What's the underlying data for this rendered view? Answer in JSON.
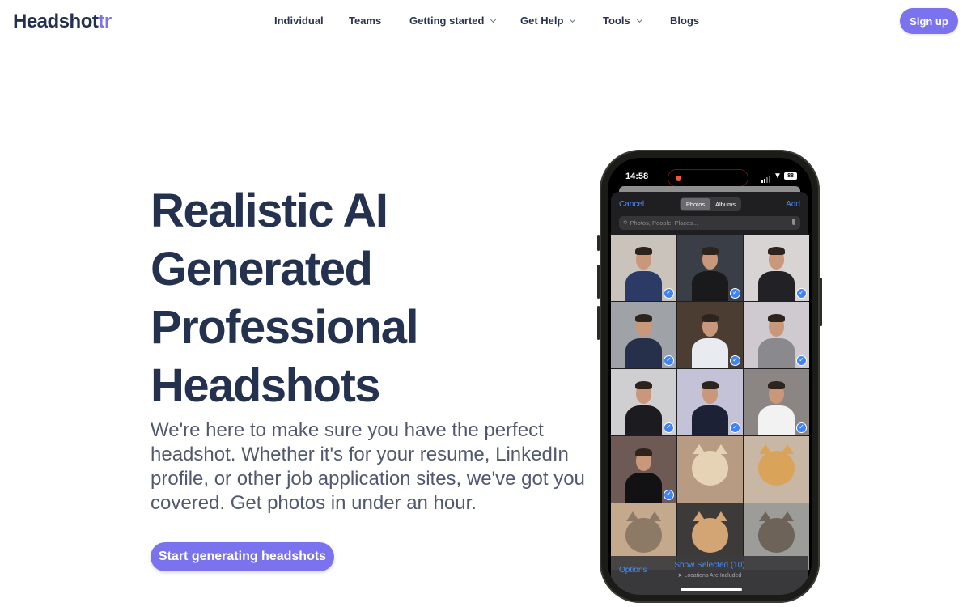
{
  "brand": {
    "name_main": "Headshot",
    "name_accent": "tr",
    "accent_color": "#7b72ee",
    "text_color": "#243250"
  },
  "nav": {
    "items": [
      {
        "label": "Individual",
        "dropdown": false
      },
      {
        "label": "Teams",
        "dropdown": false
      },
      {
        "label": "Getting started",
        "dropdown": true
      },
      {
        "label": "Get Help",
        "dropdown": true
      },
      {
        "label": "Tools",
        "dropdown": true
      },
      {
        "label": "Blogs",
        "dropdown": false
      }
    ],
    "signup_label": "Sign up"
  },
  "hero": {
    "title_lines": [
      "Realistic AI",
      "Generated",
      "Professional",
      "Headshots"
    ],
    "subtitle": "We're here to make sure you have the perfect headshot. Whether it's for your resume, LinkedIn profile, or other job application sites, we've got you covered. Get photos in under an hour.",
    "cta_label": "Start generating headshots"
  },
  "phone": {
    "status": {
      "time": "14:58",
      "battery": "88"
    },
    "picker": {
      "cancel_label": "Cancel",
      "add_label": "Add",
      "tabs": [
        {
          "label": "Photos",
          "active": true
        },
        {
          "label": "Albums",
          "active": false
        }
      ],
      "search_placeholder": "Photos, People, Places...",
      "photos": [
        {
          "kind": "person",
          "selected": true,
          "bg": "#c9c3bb",
          "shirt": "#2c3a66"
        },
        {
          "kind": "person",
          "selected": true,
          "bg": "#3a3f47",
          "shirt": "#1a1a1c"
        },
        {
          "kind": "person",
          "selected": true,
          "bg": "#d7d4d3",
          "shirt": "#222226"
        },
        {
          "kind": "person",
          "selected": true,
          "bg": "#9fa2a6",
          "shirt": "#27304a"
        },
        {
          "kind": "person",
          "selected": true,
          "bg": "#4c3d32",
          "shirt": "#e8ecf0"
        },
        {
          "kind": "person",
          "selected": true,
          "bg": "#cfcad0",
          "shirt": "#8a8a8e"
        },
        {
          "kind": "person",
          "selected": true,
          "bg": "#cfcfd1",
          "shirt": "#1c1c20"
        },
        {
          "kind": "person",
          "selected": true,
          "bg": "#c3c2d6",
          "shirt": "#1c2136"
        },
        {
          "kind": "person",
          "selected": true,
          "bg": "#8b8583",
          "shirt": "#f2f2f2"
        },
        {
          "kind": "person",
          "selected": true,
          "bg": "#6e5a55",
          "shirt": "#121214"
        },
        {
          "kind": "cat",
          "selected": false,
          "bg": "#b79c83",
          "fur": "#e6d3b6"
        },
        {
          "kind": "cat",
          "selected": false,
          "bg": "#c8b7a4",
          "fur": "#d9a45a"
        },
        {
          "kind": "cat",
          "selected": false,
          "bg": "#c4a98c",
          "fur": "#8c7966"
        },
        {
          "kind": "cat",
          "selected": false,
          "bg": "#3d3a3a",
          "fur": "#d4a574"
        },
        {
          "kind": "cat",
          "selected": false,
          "bg": "#9c9c98",
          "fur": "#6e6358"
        }
      ],
      "options_label": "Options",
      "show_selected_label": "Show Selected (10)",
      "locations_label": "➤ Locations Are Included"
    }
  }
}
